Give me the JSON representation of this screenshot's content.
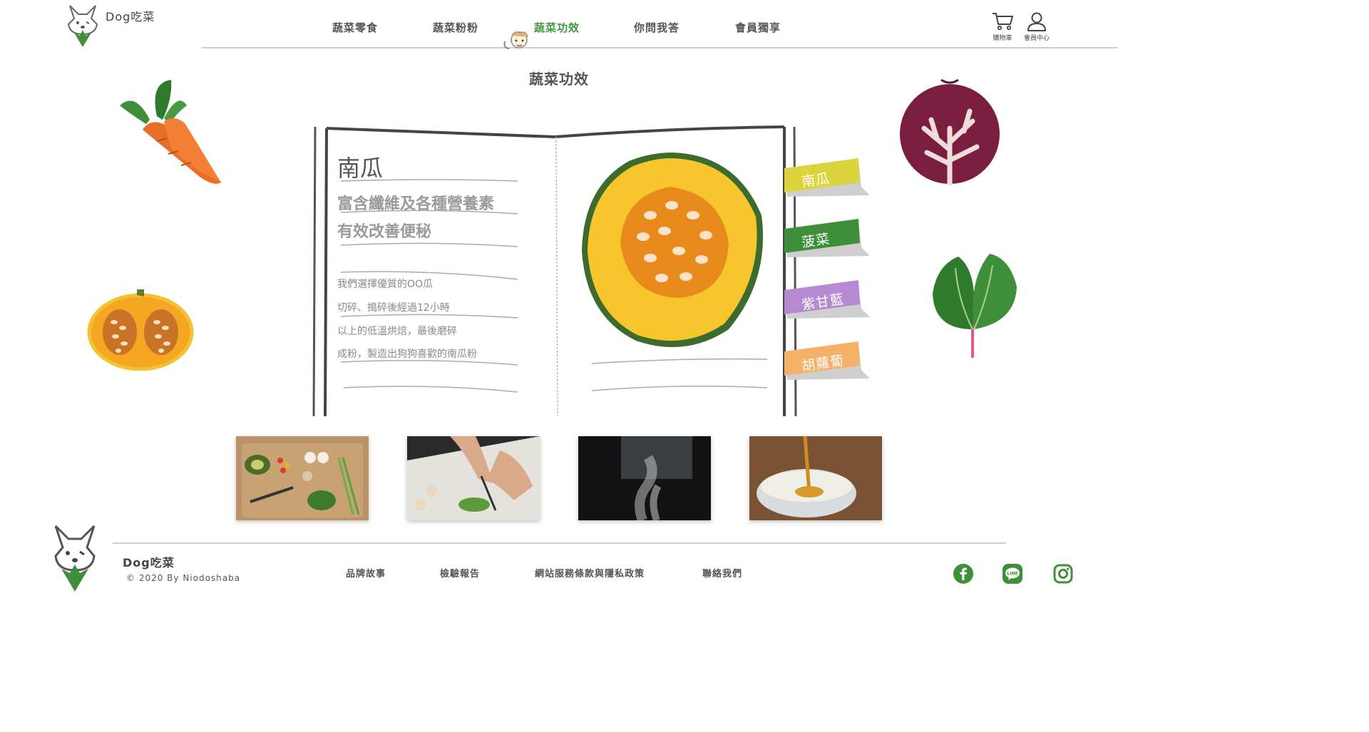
{
  "brand": {
    "name": "Dog吃菜"
  },
  "nav": [
    {
      "label": "蔬菜零食"
    },
    {
      "label": "蔬菜粉粉"
    },
    {
      "label": "蔬菜功效"
    },
    {
      "label": "你問我答"
    },
    {
      "label": "會員獨享"
    }
  ],
  "header_icons": {
    "cart_label": "購物車",
    "member_label": "會員中心"
  },
  "page_title": "蔬菜功效",
  "book": {
    "veg_name": "南瓜",
    "tagline": [
      "富含纖維及各種營養素",
      "有效改善便秘"
    ],
    "description": [
      "我們選擇優質的OO瓜",
      "切碎、搗碎後經過12小時",
      "以上的低溫烘焙，最後磨碎",
      "成粉，製造出狗狗喜歡的南瓜粉"
    ]
  },
  "tabs": [
    {
      "label": "南瓜",
      "color": "#dcd43c"
    },
    {
      "label": "菠菜",
      "color": "#3f8f3a"
    },
    {
      "label": "紫甘藍",
      "color": "#b68ad0"
    },
    {
      "label": "胡蘿蔔",
      "color": "#f5b06a"
    }
  ],
  "colors": {
    "accent_green": "#3f9a3d",
    "text": "#555555"
  },
  "footer": {
    "brand": "Dog吃菜",
    "copyright": "© 2020 By Niodoshaba",
    "links": [
      "品牌故事",
      "檢驗報告",
      "網站服務條款與隱私政策",
      "聯絡我們"
    ],
    "social": [
      "facebook-icon",
      "line-icon",
      "instagram-icon"
    ]
  }
}
